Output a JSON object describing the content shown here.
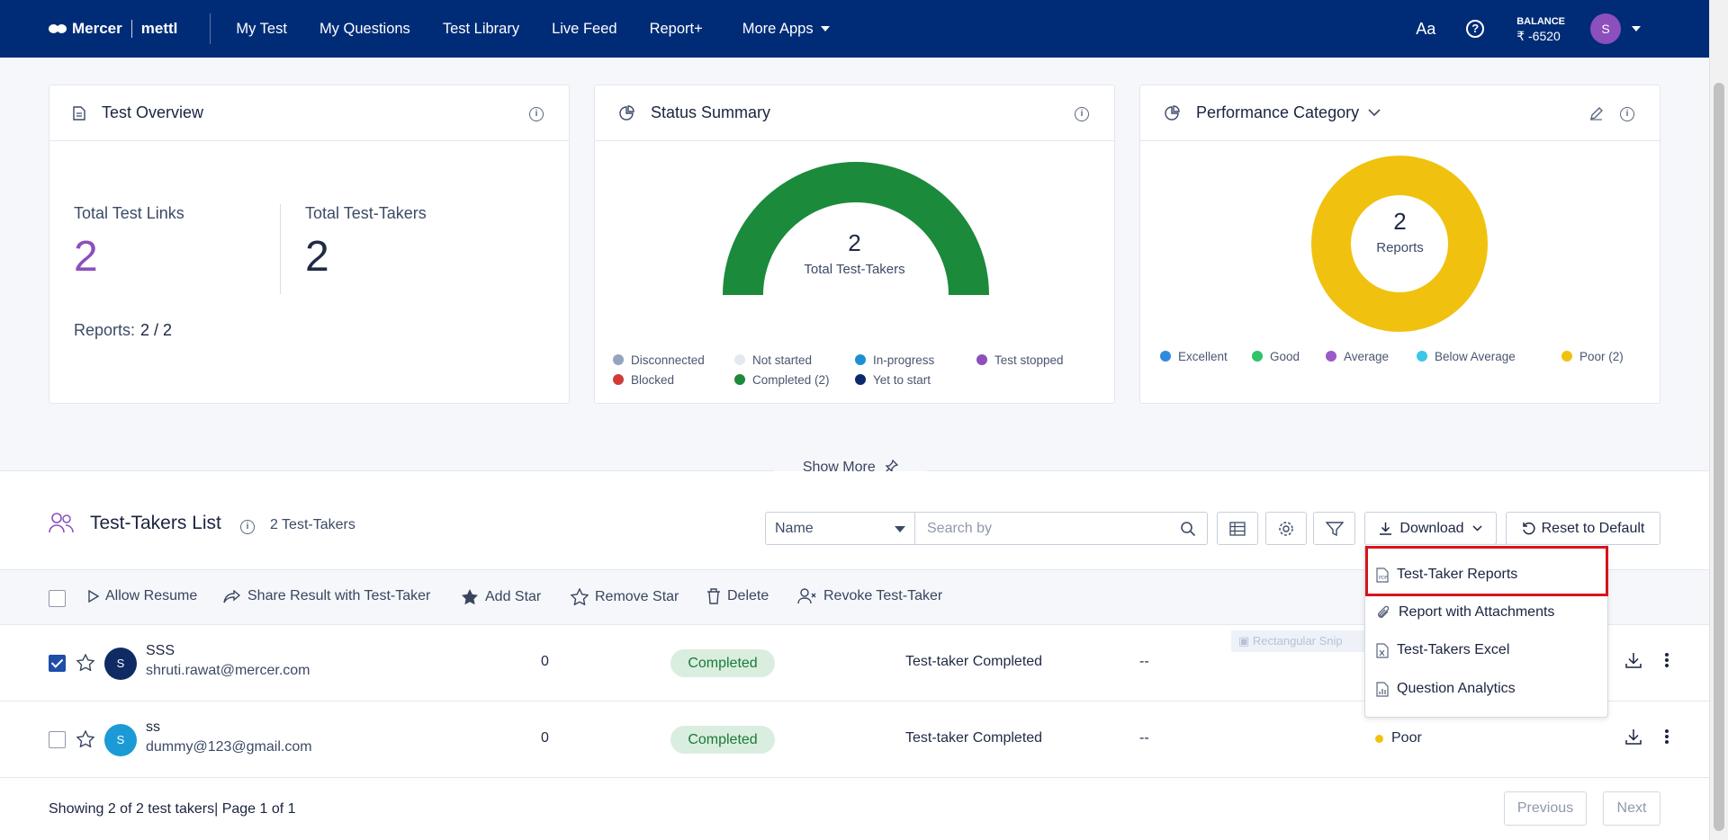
{
  "header": {
    "logo_left": "Mercer",
    "logo_right": "mettl",
    "nav": [
      "My Test",
      "My Questions",
      "Test Library",
      "Live Feed",
      "Report+"
    ],
    "more_apps": "More Apps",
    "font_toggle": "Aa",
    "help": "?",
    "balance_label": "BALANCE",
    "balance_value": "₹ -6520",
    "avatar": "S"
  },
  "overview": {
    "title": "Test Overview",
    "total_links_label": "Total Test Links",
    "total_links": "2",
    "total_takers_label": "Total Test-Takers",
    "total_takers": "2",
    "reports_label": "Reports:",
    "reports_value": "2 / 2"
  },
  "status": {
    "title": "Status Summary",
    "center_value": "2",
    "center_label": "Total Test-Takers",
    "legend": [
      {
        "label": "Disconnected",
        "color": "#94a3c0"
      },
      {
        "label": "Not started",
        "color": "#e4e8ef"
      },
      {
        "label": "In-progress",
        "color": "#1f8fd3"
      },
      {
        "label": "Test stopped",
        "color": "#8c4fbc"
      },
      {
        "label": "Blocked",
        "color": "#d23a3a"
      },
      {
        "label": "Completed (2)",
        "color": "#1b8a3b"
      },
      {
        "label": "Yet to start",
        "color": "#0c2a6b"
      }
    ]
  },
  "performance": {
    "title": "Performance Category",
    "center_value": "2",
    "center_label": "Reports",
    "legend": [
      {
        "label": "Excellent",
        "color": "#2e8ce0"
      },
      {
        "label": "Good",
        "color": "#2ec46a"
      },
      {
        "label": "Average",
        "color": "#9b59c9"
      },
      {
        "label": "Below Average",
        "color": "#3cc6e8"
      },
      {
        "label": "Poor (2)",
        "color": "#f0c20f"
      }
    ]
  },
  "show_more": "Show More",
  "list": {
    "title": "Test-Takers List",
    "count": "2 Test-Takers",
    "filter_select": "Name",
    "search_placeholder": "Search by",
    "download": "Download",
    "reset": "Reset to Default",
    "actions": [
      "Allow Resume",
      "Share Result with Test-Taker",
      "Add Star",
      "Remove Star",
      "Delete",
      "Revoke Test-Taker"
    ],
    "rows": [
      {
        "initial": "S",
        "name": "SSS",
        "email": "shruti.rawat@mercer.com",
        "score": "0",
        "status": "Completed",
        "state": "Test-taker Completed",
        "dash": "--",
        "perf": "",
        "checked": true,
        "avatar_color": "#102a63"
      },
      {
        "initial": "S",
        "name": "ss",
        "email": "dummy@123@gmail.com",
        "score": "0",
        "status": "Completed",
        "state": "Test-taker Completed",
        "dash": "--",
        "perf": "Poor",
        "checked": false,
        "avatar_color": "#1b9ad6"
      }
    ],
    "footer": "Showing 2 of 2 test takers| Page 1 of 1",
    "prev": "Previous",
    "next": "Next"
  },
  "download_menu": [
    "Test-Taker Reports",
    "Report with Attachments",
    "Test-Takers Excel",
    "Question Analytics"
  ],
  "ghost_text": "Rectangular Snip"
}
